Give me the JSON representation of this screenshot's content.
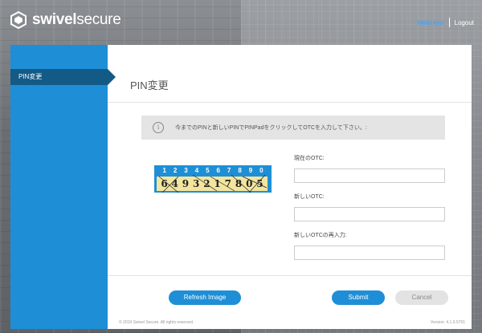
{
  "brand": {
    "name_bold": "swivel",
    "name_light": "secure"
  },
  "topnav": {
    "user": "Hello test",
    "logout": "Logout"
  },
  "sidebar": {
    "items": [
      {
        "label": "PIN変更"
      }
    ]
  },
  "page": {
    "title": "PIN変更"
  },
  "info": {
    "message": "今までのPINと新しいPINでPINPadをクリックしてOTCを入力して下さい。:"
  },
  "pinpad": {
    "digits": [
      "1",
      "2",
      "3",
      "4",
      "5",
      "6",
      "7",
      "8",
      "9",
      "0"
    ],
    "scrambled": [
      "6",
      "4",
      "9",
      "3",
      "2",
      "1",
      "7",
      "8",
      "0",
      "5"
    ]
  },
  "form": {
    "current_otc_label": "現在のOTC:",
    "new_otc_label": "新しいOTC:",
    "confirm_otc_label": "新しいOTCの再入力:",
    "current_otc_value": "",
    "new_otc_value": "",
    "confirm_otc_value": ""
  },
  "buttons": {
    "refresh": "Refresh Image",
    "submit": "Submit",
    "cancel": "Cancel"
  },
  "footer": {
    "copyright": "© 2019 Swivel Secure. All rights reserved.",
    "version": "Version: 4.1.0.5791"
  },
  "colors": {
    "accent": "#1e8fd6",
    "sidebar_active": "#145a86",
    "pin_strip": "#f3e59d"
  }
}
